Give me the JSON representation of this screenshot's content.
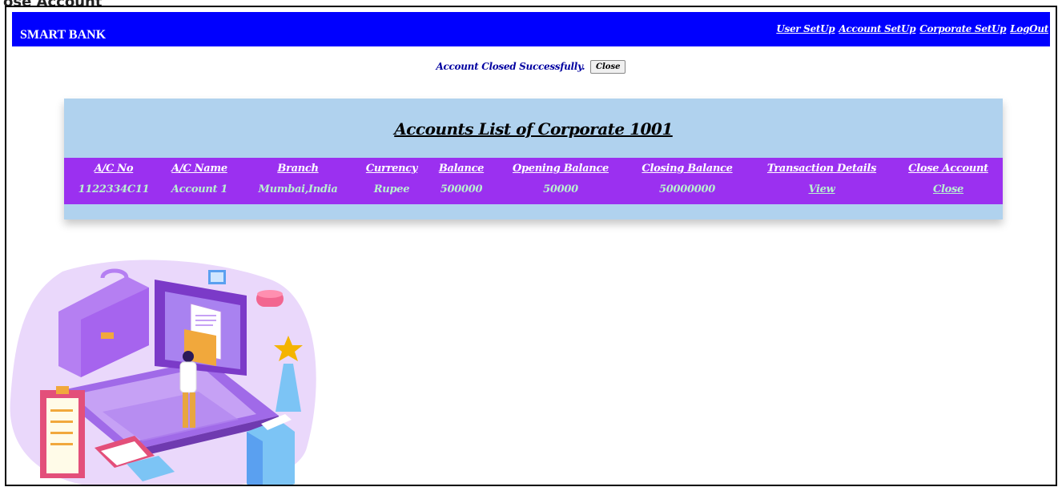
{
  "header": {
    "cut_title": "ose Account",
    "brand": "SMART BANK",
    "nav": [
      "User SetUp",
      "Account SetUp",
      "Corporate SetUp",
      "LogOut"
    ]
  },
  "message": {
    "text": "Account Closed Successfully.",
    "button": "Close"
  },
  "panel": {
    "title": "Accounts List of Corporate 1001",
    "columns": [
      "A/C No",
      "A/C Name",
      "Branch",
      "Currency",
      "Balance",
      "Opening Balance",
      "Closing Balance",
      "Transaction Details",
      "Close Account"
    ],
    "rows": [
      [
        "1122334C11",
        "Account 1",
        "Mumbai,India",
        "Rupee",
        "500000",
        "50000",
        "50000000",
        "View",
        "Close"
      ]
    ]
  },
  "colors": {
    "topbar": "#0000ff",
    "panel": "#b0d2ee",
    "table": "#9b30f0",
    "data_text": "#b8f0d0"
  },
  "illustration": {
    "icon": "office-laptop-illustration"
  }
}
